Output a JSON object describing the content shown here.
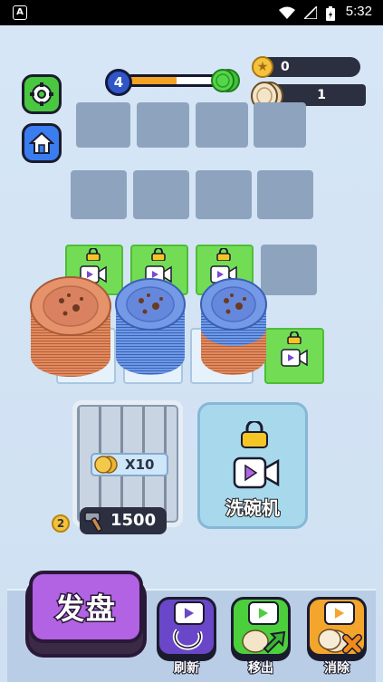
{
  "status_bar": {
    "time": "5:32",
    "app_icon": "A"
  },
  "hud": {
    "level": "4",
    "level_progress": 0.52,
    "coins": "0",
    "plates": "1"
  },
  "rack": {
    "multiplier": "X10",
    "price": "1500",
    "owned_count": "2"
  },
  "dishwasher": {
    "label": "洗碗机"
  },
  "deal_button": {
    "label": "发盘"
  },
  "tools": [
    {
      "label": "刷新"
    },
    {
      "label": "移出"
    },
    {
      "label": "消除"
    }
  ],
  "colors": {
    "orange_plate": "#e28a61",
    "blue_plate": "#6c8fe0",
    "accent_purple": "#b263e3"
  },
  "icons": [
    "settings-icon",
    "home-icon",
    "lock-icon",
    "video-icon",
    "coin-icon",
    "hammer-icon"
  ]
}
